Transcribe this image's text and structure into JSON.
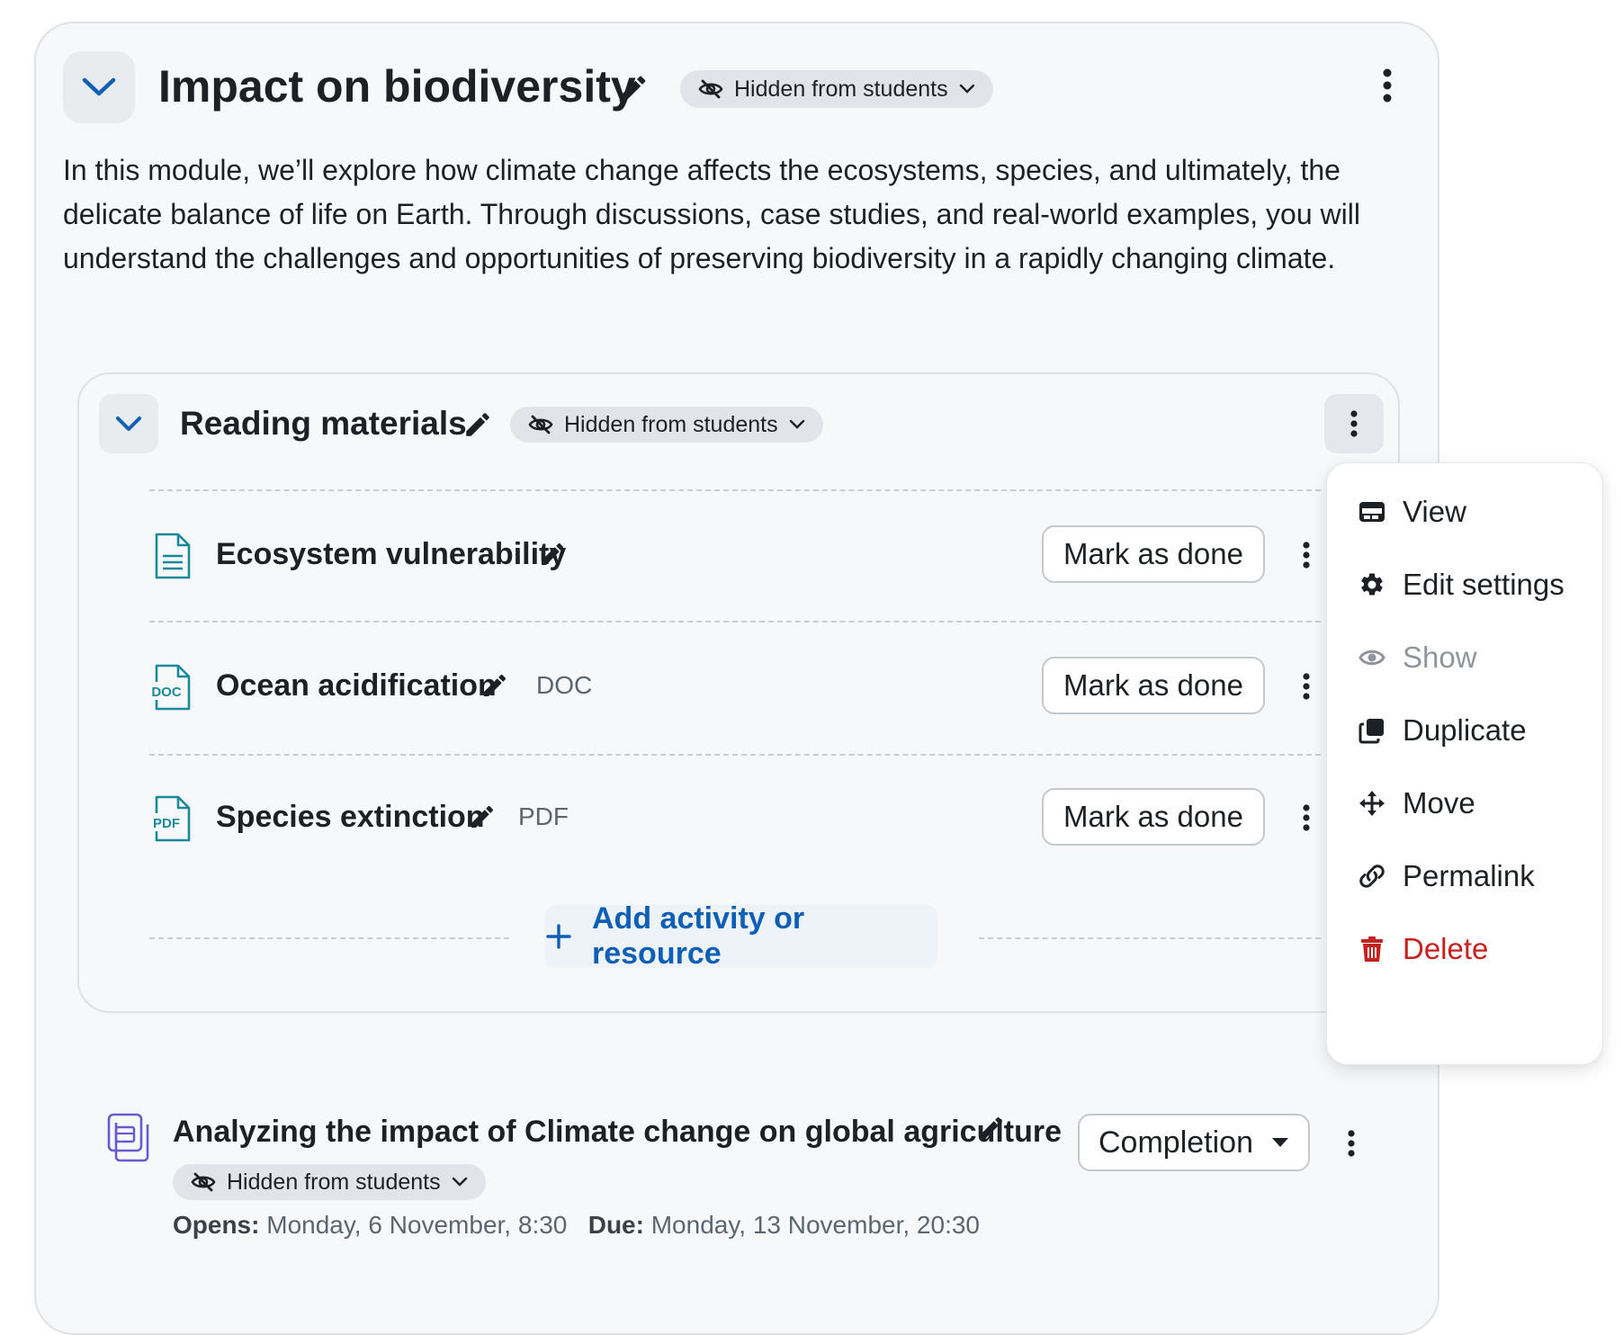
{
  "module": {
    "title": "Impact on biodiversity",
    "visibility_badge": "Hidden from students",
    "description": "In this module, we’ll explore how climate change affects the ecosystems, species, and ultimately, the delicate balance of life on Earth. Through discussions, case studies, and real-world examples, you will understand the challenges and opportunities of preserving biodiversity in a rapidly changing climate."
  },
  "section": {
    "title": "Reading materials",
    "visibility_badge": "Hidden from students",
    "activities": [
      {
        "name": "Ecosystem vulnerability",
        "type_label": "",
        "icon": "document-icon",
        "button": "Mark as done"
      },
      {
        "name": "Ocean acidification",
        "type_label": "DOC",
        "icon": "doc-file-icon",
        "button": "Mark as done"
      },
      {
        "name": "Species extinction",
        "type_label": "PDF",
        "icon": "pdf-file-icon",
        "button": "Mark as done"
      }
    ],
    "add_button": "Add activity or resource"
  },
  "context_menu": {
    "items": [
      {
        "label": "View",
        "icon": "view-icon",
        "state": "normal"
      },
      {
        "label": "Edit settings",
        "icon": "gear-icon",
        "state": "normal"
      },
      {
        "label": "Show",
        "icon": "eye-icon",
        "state": "disabled"
      },
      {
        "label": "Duplicate",
        "icon": "duplicate-icon",
        "state": "normal"
      },
      {
        "label": "Move",
        "icon": "move-icon",
        "state": "normal"
      },
      {
        "label": "Permalink",
        "icon": "link-icon",
        "state": "normal"
      },
      {
        "label": "Delete",
        "icon": "trash-icon",
        "state": "danger"
      }
    ]
  },
  "assignment": {
    "title": "Analyzing the impact of Climate change on global agriculture",
    "visibility_badge": "Hidden from students",
    "completion_button": "Completion",
    "opens_label": "Opens:",
    "opens_value": "Monday, 6 November, 8:30",
    "due_label": "Due:",
    "due_value": "Monday, 13 November, 20:30"
  },
  "colors": {
    "accent": "#0f5fb5",
    "danger": "#c5221f",
    "file_icon": "#1a8a9a",
    "assignment_icon": "#6a5acd"
  }
}
